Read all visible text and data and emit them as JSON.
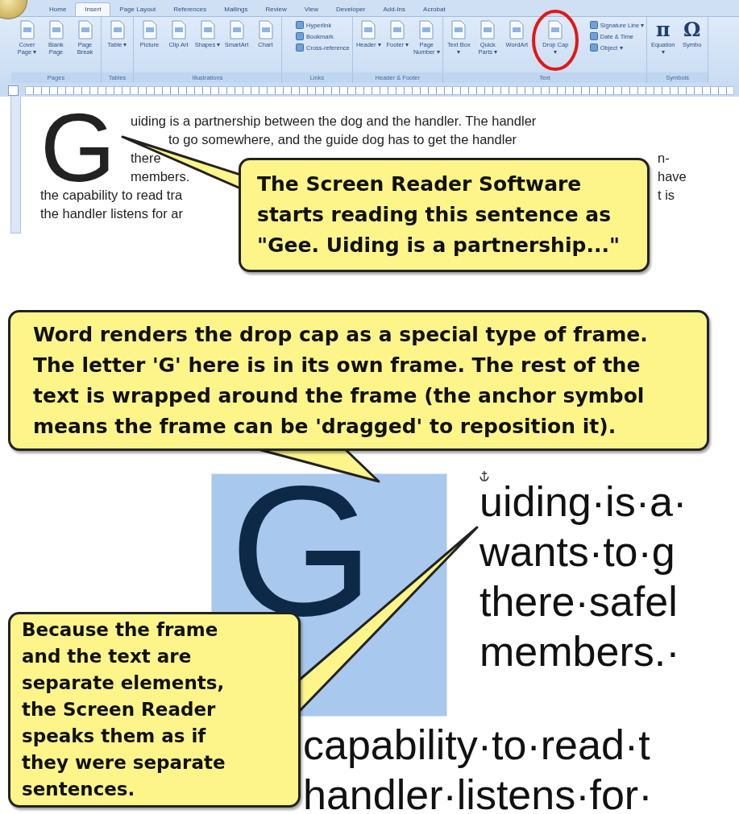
{
  "ribbon": {
    "tabs": [
      {
        "label": "Home",
        "selected": false
      },
      {
        "label": "Insert",
        "selected": true
      },
      {
        "label": "Page Layout",
        "selected": false
      },
      {
        "label": "References",
        "selected": false
      },
      {
        "label": "Mailings",
        "selected": false
      },
      {
        "label": "Review",
        "selected": false
      },
      {
        "label": "View",
        "selected": false
      },
      {
        "label": "Developer",
        "selected": false
      },
      {
        "label": "Add-Ins",
        "selected": false
      },
      {
        "label": "Acrobat",
        "selected": false
      }
    ],
    "groups": [
      {
        "label": "Pages",
        "buttons": [
          {
            "kind": "large",
            "label": "Cover Page ▾"
          },
          {
            "kind": "large",
            "label": "Blank Page"
          },
          {
            "kind": "large",
            "label": "Page Break"
          }
        ]
      },
      {
        "label": "Tables",
        "buttons": [
          {
            "kind": "large",
            "label": "Table ▾"
          }
        ]
      },
      {
        "label": "Illustrations",
        "buttons": [
          {
            "kind": "large",
            "label": "Picture"
          },
          {
            "kind": "large",
            "label": "Clip Art"
          },
          {
            "kind": "large",
            "label": "Shapes ▾"
          },
          {
            "kind": "large",
            "label": "SmartArt"
          },
          {
            "kind": "large",
            "label": "Chart"
          }
        ]
      },
      {
        "label": "Links",
        "buttons": [
          {
            "kind": "small",
            "label": "Hyperlink"
          },
          {
            "kind": "small",
            "label": "Bookmark"
          },
          {
            "kind": "small",
            "label": "Cross-reference"
          }
        ]
      },
      {
        "label": "Header & Footer",
        "buttons": [
          {
            "kind": "large",
            "label": "Header ▾"
          },
          {
            "kind": "large",
            "label": "Footer ▾"
          },
          {
            "kind": "large",
            "label": "Page Number ▾"
          }
        ]
      },
      {
        "label": "Text",
        "buttons": [
          {
            "kind": "large",
            "label": "Text Box ▾"
          },
          {
            "kind": "large",
            "label": "Quick Parts ▾"
          },
          {
            "kind": "large",
            "label": "WordArt"
          },
          {
            "kind": "large",
            "label": "Drop Cap ▾"
          },
          {
            "kind": "small",
            "label": "Signature Line ▾"
          },
          {
            "kind": "small",
            "label": "Date & Time"
          },
          {
            "kind": "small",
            "label": "Object ▾"
          }
        ]
      },
      {
        "label": "Symbols",
        "buttons": [
          {
            "kind": "glyph",
            "glyph": "π",
            "label": "Equation ▾"
          },
          {
            "kind": "glyph",
            "glyph": "Ω",
            "label": "Symbo"
          }
        ]
      }
    ]
  },
  "document": {
    "drop_cap": "G",
    "lines": [
      {
        "parts": [
          "uiding is a partnership between the dog and the handler. The handler"
        ]
      },
      {
        "parts": [
          "to go somewhere, and the guide dog has to get the handler"
        ]
      },
      {
        "parts": [
          "there",
          "n-"
        ]
      },
      {
        "parts": [
          "members.",
          "have"
        ]
      },
      {
        "parts": [
          "the capability to read tra",
          "t is"
        ]
      },
      {
        "parts": [
          "the handler listens for ar"
        ]
      }
    ]
  },
  "zoomed_view": {
    "drop_cap": "G",
    "lines": [
      "uiding·is·a·",
      "wants·to·g",
      "there·safel",
      "members.·",
      "capability·to·read·t",
      "handler·listens·for·"
    ]
  },
  "callouts": [
    {
      "text": "The Screen Reader Software starts reading this sentence as \"Gee. Uiding is a partnership...\""
    },
    {
      "text": "Word renders the drop cap as a special type of frame. The letter 'G' here is in its own frame. The rest of the text is wrapped around the frame (the anchor symbol means the frame can be 'dragged' to reposition it)."
    },
    {
      "text": "Because the frame and the text are separate elements, the Screen Reader speaks them as if they were separate sentences."
    }
  ]
}
